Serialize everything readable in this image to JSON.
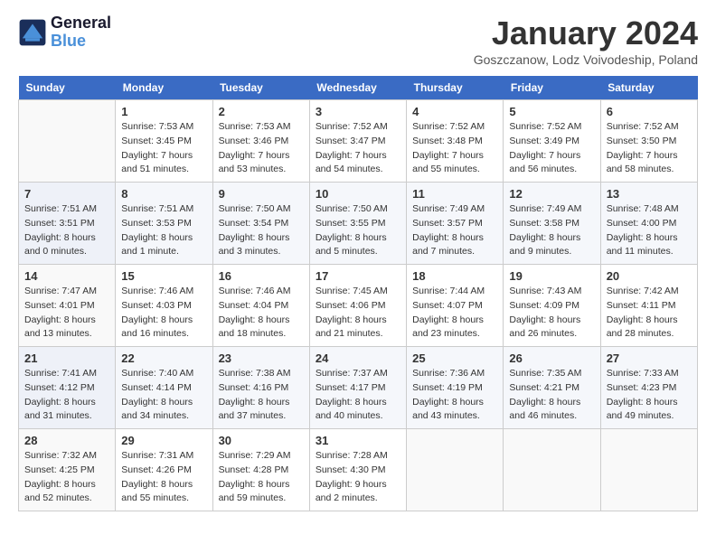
{
  "header": {
    "logo_line1": "General",
    "logo_line2": "Blue",
    "title": "January 2024",
    "subtitle": "Goszczanow, Lodz Voivodeship, Poland"
  },
  "days_of_week": [
    "Sunday",
    "Monday",
    "Tuesday",
    "Wednesday",
    "Thursday",
    "Friday",
    "Saturday"
  ],
  "weeks": [
    [
      {
        "date": "",
        "info": ""
      },
      {
        "date": "1",
        "info": "Sunrise: 7:53 AM\nSunset: 3:45 PM\nDaylight: 7 hours\nand 51 minutes."
      },
      {
        "date": "2",
        "info": "Sunrise: 7:53 AM\nSunset: 3:46 PM\nDaylight: 7 hours\nand 53 minutes."
      },
      {
        "date": "3",
        "info": "Sunrise: 7:52 AM\nSunset: 3:47 PM\nDaylight: 7 hours\nand 54 minutes."
      },
      {
        "date": "4",
        "info": "Sunrise: 7:52 AM\nSunset: 3:48 PM\nDaylight: 7 hours\nand 55 minutes."
      },
      {
        "date": "5",
        "info": "Sunrise: 7:52 AM\nSunset: 3:49 PM\nDaylight: 7 hours\nand 56 minutes."
      },
      {
        "date": "6",
        "info": "Sunrise: 7:52 AM\nSunset: 3:50 PM\nDaylight: 7 hours\nand 58 minutes."
      }
    ],
    [
      {
        "date": "7",
        "info": "Sunrise: 7:51 AM\nSunset: 3:51 PM\nDaylight: 8 hours\nand 0 minutes."
      },
      {
        "date": "8",
        "info": "Sunrise: 7:51 AM\nSunset: 3:53 PM\nDaylight: 8 hours\nand 1 minute."
      },
      {
        "date": "9",
        "info": "Sunrise: 7:50 AM\nSunset: 3:54 PM\nDaylight: 8 hours\nand 3 minutes."
      },
      {
        "date": "10",
        "info": "Sunrise: 7:50 AM\nSunset: 3:55 PM\nDaylight: 8 hours\nand 5 minutes."
      },
      {
        "date": "11",
        "info": "Sunrise: 7:49 AM\nSunset: 3:57 PM\nDaylight: 8 hours\nand 7 minutes."
      },
      {
        "date": "12",
        "info": "Sunrise: 7:49 AM\nSunset: 3:58 PM\nDaylight: 8 hours\nand 9 minutes."
      },
      {
        "date": "13",
        "info": "Sunrise: 7:48 AM\nSunset: 4:00 PM\nDaylight: 8 hours\nand 11 minutes."
      }
    ],
    [
      {
        "date": "14",
        "info": "Sunrise: 7:47 AM\nSunset: 4:01 PM\nDaylight: 8 hours\nand 13 minutes."
      },
      {
        "date": "15",
        "info": "Sunrise: 7:46 AM\nSunset: 4:03 PM\nDaylight: 8 hours\nand 16 minutes."
      },
      {
        "date": "16",
        "info": "Sunrise: 7:46 AM\nSunset: 4:04 PM\nDaylight: 8 hours\nand 18 minutes."
      },
      {
        "date": "17",
        "info": "Sunrise: 7:45 AM\nSunset: 4:06 PM\nDaylight: 8 hours\nand 21 minutes."
      },
      {
        "date": "18",
        "info": "Sunrise: 7:44 AM\nSunset: 4:07 PM\nDaylight: 8 hours\nand 23 minutes."
      },
      {
        "date": "19",
        "info": "Sunrise: 7:43 AM\nSunset: 4:09 PM\nDaylight: 8 hours\nand 26 minutes."
      },
      {
        "date": "20",
        "info": "Sunrise: 7:42 AM\nSunset: 4:11 PM\nDaylight: 8 hours\nand 28 minutes."
      }
    ],
    [
      {
        "date": "21",
        "info": "Sunrise: 7:41 AM\nSunset: 4:12 PM\nDaylight: 8 hours\nand 31 minutes."
      },
      {
        "date": "22",
        "info": "Sunrise: 7:40 AM\nSunset: 4:14 PM\nDaylight: 8 hours\nand 34 minutes."
      },
      {
        "date": "23",
        "info": "Sunrise: 7:38 AM\nSunset: 4:16 PM\nDaylight: 8 hours\nand 37 minutes."
      },
      {
        "date": "24",
        "info": "Sunrise: 7:37 AM\nSunset: 4:17 PM\nDaylight: 8 hours\nand 40 minutes."
      },
      {
        "date": "25",
        "info": "Sunrise: 7:36 AM\nSunset: 4:19 PM\nDaylight: 8 hours\nand 43 minutes."
      },
      {
        "date": "26",
        "info": "Sunrise: 7:35 AM\nSunset: 4:21 PM\nDaylight: 8 hours\nand 46 minutes."
      },
      {
        "date": "27",
        "info": "Sunrise: 7:33 AM\nSunset: 4:23 PM\nDaylight: 8 hours\nand 49 minutes."
      }
    ],
    [
      {
        "date": "28",
        "info": "Sunrise: 7:32 AM\nSunset: 4:25 PM\nDaylight: 8 hours\nand 52 minutes."
      },
      {
        "date": "29",
        "info": "Sunrise: 7:31 AM\nSunset: 4:26 PM\nDaylight: 8 hours\nand 55 minutes."
      },
      {
        "date": "30",
        "info": "Sunrise: 7:29 AM\nSunset: 4:28 PM\nDaylight: 8 hours\nand 59 minutes."
      },
      {
        "date": "31",
        "info": "Sunrise: 7:28 AM\nSunset: 4:30 PM\nDaylight: 9 hours\nand 2 minutes."
      },
      {
        "date": "",
        "info": ""
      },
      {
        "date": "",
        "info": ""
      },
      {
        "date": "",
        "info": ""
      }
    ]
  ]
}
